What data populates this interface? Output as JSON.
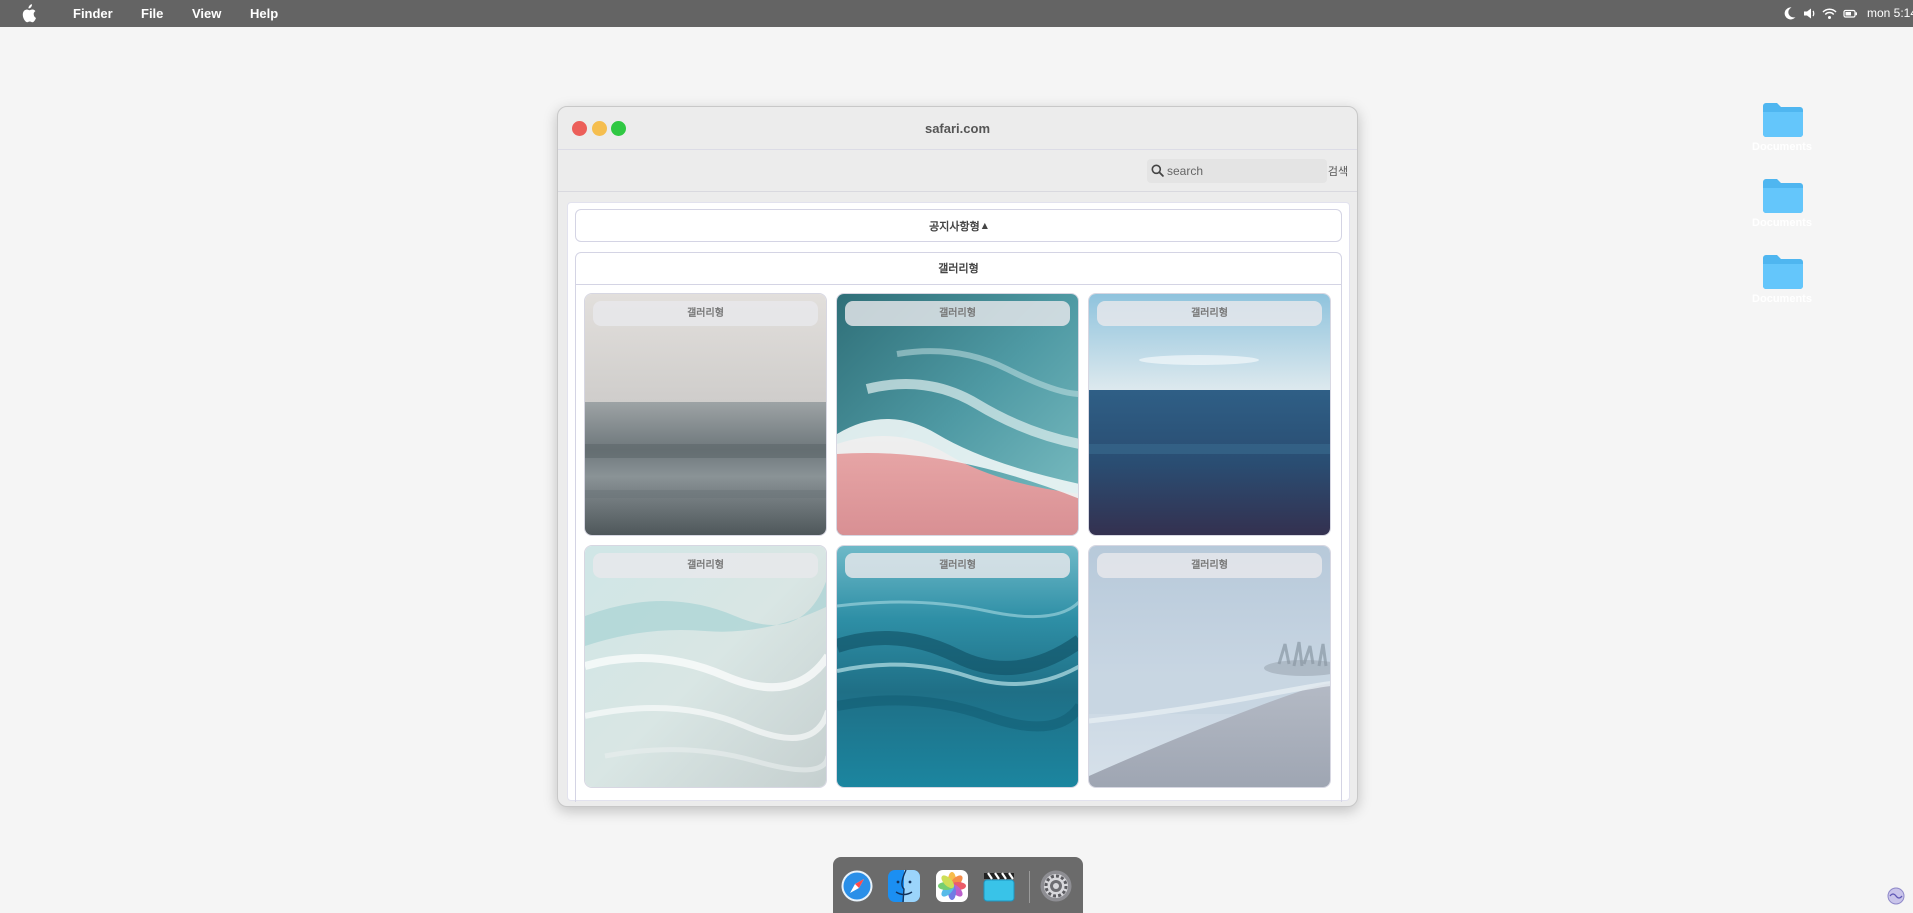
{
  "menubar": {
    "items": [
      "Finder",
      "File",
      "View",
      "Help"
    ],
    "clock": "mon 5:14",
    "status_icons": [
      "moon-icon",
      "speaker-icon",
      "wifi-icon",
      "battery-icon"
    ]
  },
  "desktop": {
    "folders": [
      {
        "label": "Documents"
      },
      {
        "label": "Documents"
      },
      {
        "label": "Documents"
      }
    ]
  },
  "window": {
    "title": "safari.com",
    "search": {
      "placeholder": "search",
      "value": "",
      "submit_label": "검색"
    },
    "notice_toggle": {
      "label": "공지사항형",
      "caret": "▲"
    },
    "gallery": {
      "title": "갤러리형",
      "items": [
        {
          "caption": "갤러리형",
          "scene": "foggy-sea"
        },
        {
          "caption": "갤러리형",
          "scene": "wave-pink-sand"
        },
        {
          "caption": "갤러리형",
          "scene": "deep-blue-horizon"
        },
        {
          "caption": "갤러리형",
          "scene": "foamy-shallow"
        },
        {
          "caption": "갤러리형",
          "scene": "teal-waves"
        },
        {
          "caption": "갤러리형",
          "scene": "misty-beach"
        }
      ]
    }
  },
  "dock": {
    "apps": [
      "safari-icon",
      "finder-icon",
      "photos-icon",
      "clips-icon",
      "system-preferences-icon"
    ]
  },
  "colors": {
    "menubar": "#646464",
    "desktop": "#f5f5f5",
    "folder": "#5ac8fa",
    "close": "#ec5f5a",
    "minimize": "#f5be4f",
    "maximize": "#30c843"
  }
}
